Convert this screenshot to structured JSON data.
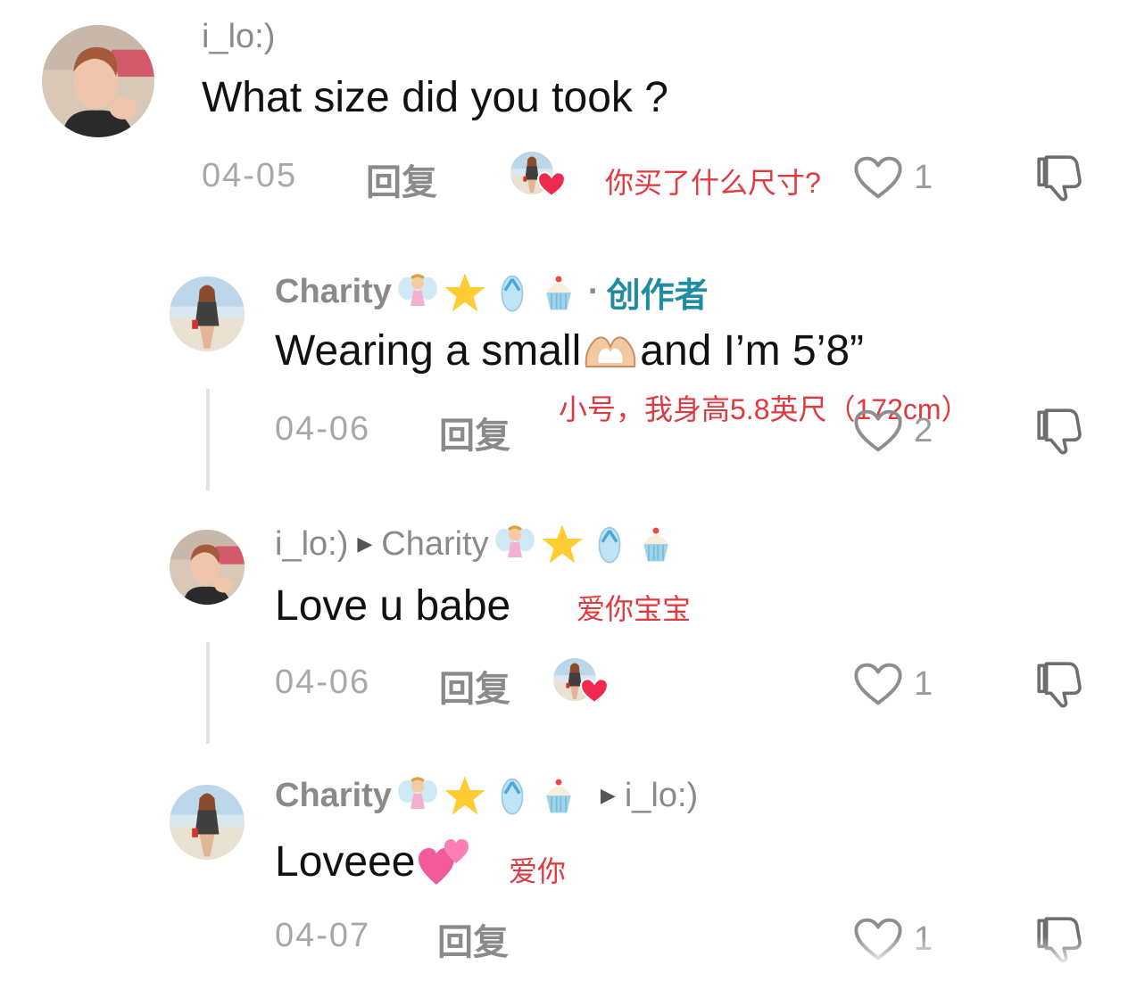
{
  "comments": [
    {
      "user": "i_lo:)",
      "text": "What size did you took ?",
      "date": "04-05",
      "reply_label": "回复",
      "translation": "你买了什么尺寸?",
      "likes": "1",
      "creator_liked": true
    },
    {
      "user": "Charity",
      "badge_separator": "·",
      "badge": "创作者",
      "text_before": "Wearing a small",
      "text_after": "and I’m 5’8”",
      "date": "04-06",
      "reply_label": "回复",
      "translation": "小号，我身高5.8英尺（172cm）",
      "likes": "2"
    },
    {
      "user": "i_lo:)",
      "reply_to": "Charity",
      "text": "Love u babe",
      "date": "04-06",
      "reply_label": "回复",
      "translation": "爱你宝宝",
      "likes": "1",
      "creator_liked": true
    },
    {
      "user": "Charity",
      "reply_to": "i_lo:)",
      "text": "Loveee",
      "date": "04-07",
      "reply_label": "回复",
      "translation": "爱你",
      "likes": "1"
    }
  ],
  "icons": {
    "like": "heart-outline-icon",
    "dislike": "thumbs-down-icon",
    "user_emojis": [
      "fairy-emoji",
      "star-emoji",
      "flip-flop-emoji",
      "cupcake-emoji"
    ],
    "hand_heart": "heart-hands-emoji",
    "two_hearts": "two-hearts-emoji",
    "reply_arrow": "triangle-right-icon"
  },
  "colors": {
    "username": "#8a8a8a",
    "translation": "#e0393e",
    "creator_badge": "#1f8da1",
    "liked_heart": "#f0294f"
  }
}
